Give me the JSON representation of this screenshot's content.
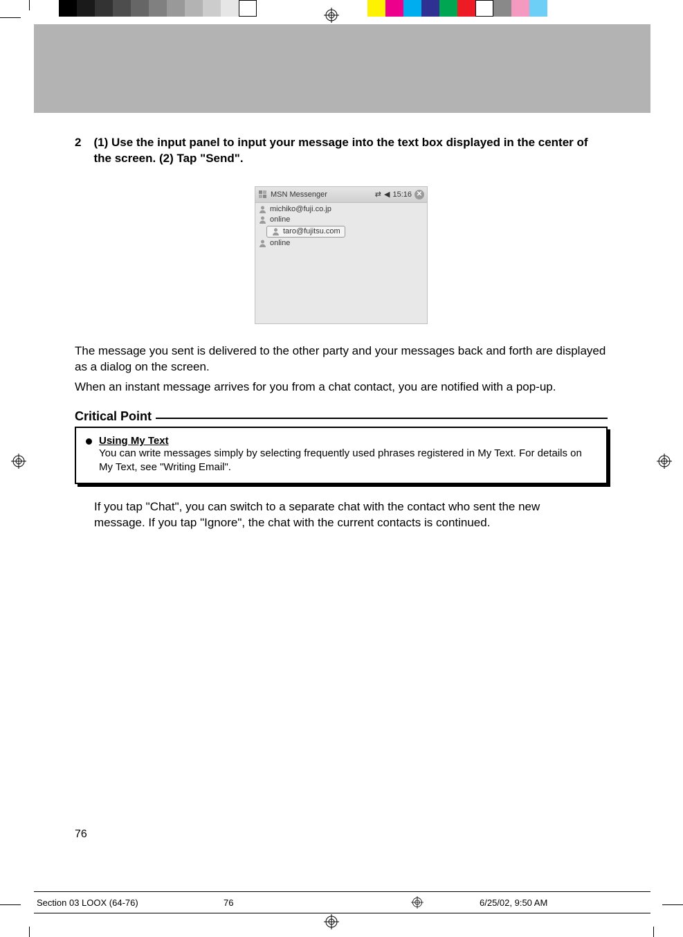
{
  "step": {
    "number": "2",
    "text": "(1) Use the input panel to input your message into the text box displayed in the center of the screen. (2) Tap \"Send\"."
  },
  "screenshot": {
    "app_title": "MSN Messenger",
    "time": "15:16",
    "close_glyph": "✕",
    "conn_glyph": "⇄",
    "vol_glyph": "◀",
    "rows": [
      {
        "text": "michiko@fuji.co.jp"
      },
      {
        "text": "online"
      },
      {
        "text_chip": "taro@fujitsu.com"
      },
      {
        "text": "online"
      }
    ]
  },
  "para1": "The message you sent is delivered to the other party and your messages back and forth are displayed as a dialog on the screen.",
  "para2": "When an instant message arrives for you from a chat contact, you are notified with a pop-up.",
  "critical": {
    "label": "Critical Point",
    "heading": "Using My Text",
    "body": "You can write messages simply by selecting frequently used phrases registered in My Text. For details on My Text, see \"Writing Email\"."
  },
  "after": "If you tap \"Chat\", you can switch to a separate chat with the contact who sent the new message. If you tap \"Ignore\", the chat with the current contacts is continued.",
  "page_number": "76",
  "slug": {
    "file": "Section 03 LOOX (64-76)",
    "page": "76",
    "date": "6/25/02, 9:50 AM"
  },
  "colorbar": [
    "#000000",
    "#1a1a1a",
    "#333333",
    "#4d4d4d",
    "#666666",
    "#808080",
    "#999999",
    "#b3b3b3",
    "#cccccc",
    "#e6e6e6",
    "#ffffff",
    null,
    "#fff200",
    "#ec008c",
    "#00aeef",
    "#2e3192",
    "#00a651",
    "#ed1c24",
    "#ffffff",
    "#898989",
    "#f49ac1",
    "#6dcff6"
  ]
}
